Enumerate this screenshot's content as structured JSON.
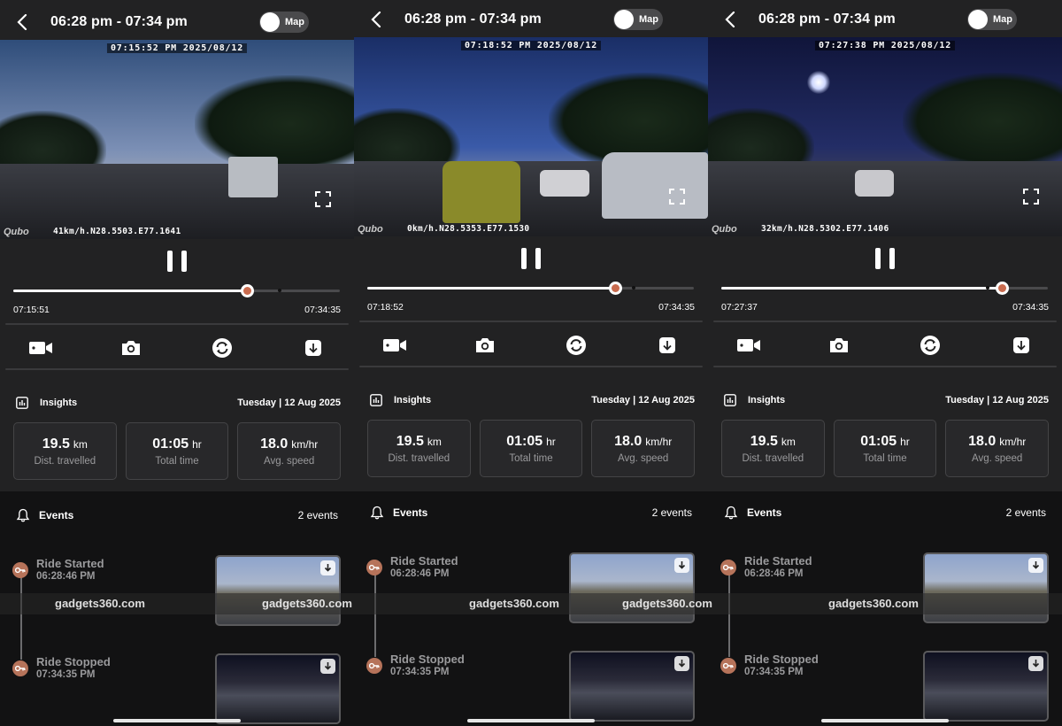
{
  "panels": [
    {
      "header": {
        "title": "06:28 pm - 07:34 pm",
        "map_label": "Map"
      },
      "video": {
        "timestamp": "07:15:52 PM 2025/08/12",
        "gps": "41km/h.N28.5503.E77.1641",
        "logo": "Qubo"
      },
      "playback": {
        "current": "07:15:51",
        "end": "07:34:35",
        "progress": 0.716
      },
      "insights": {
        "title": "Insights",
        "date": "Tuesday | 12 Aug 2025",
        "cards": [
          {
            "value": "19.5",
            "unit": "km",
            "caption": "Dist. travelled"
          },
          {
            "value": "01:05",
            "unit": "hr",
            "caption": "Total time"
          },
          {
            "value": "18.0",
            "unit": "km/hr",
            "caption": "Avg. speed"
          }
        ]
      },
      "events": {
        "title": "Events",
        "count": "2 events",
        "items": [
          {
            "name": "Ride Started",
            "time": "06:28:46 PM"
          },
          {
            "name": "Ride Stopped",
            "time": "07:34:35 PM"
          }
        ]
      }
    },
    {
      "header": {
        "title": "06:28 pm - 07:34 pm",
        "map_label": "Map"
      },
      "video": {
        "timestamp": "07:18:52 PM 2025/08/12",
        "gps": "0km/h.N28.5353.E77.1530",
        "logo": "Qubo"
      },
      "playback": {
        "current": "07:18:52",
        "end": "07:34:35",
        "progress": 0.76
      },
      "insights": {
        "title": "Insights",
        "date": "Tuesday | 12 Aug 2025",
        "cards": [
          {
            "value": "19.5",
            "unit": "km",
            "caption": "Dist. travelled"
          },
          {
            "value": "01:05",
            "unit": "hr",
            "caption": "Total time"
          },
          {
            "value": "18.0",
            "unit": "km/hr",
            "caption": "Avg. speed"
          }
        ]
      },
      "events": {
        "title": "Events",
        "count": "2 events",
        "items": [
          {
            "name": "Ride Started",
            "time": "06:28:46 PM"
          },
          {
            "name": "Ride Stopped",
            "time": "07:34:35 PM"
          }
        ]
      }
    },
    {
      "header": {
        "title": "06:28 pm - 07:34 pm",
        "map_label": "Map"
      },
      "video": {
        "timestamp": "07:27:38 PM 2025/08/12",
        "gps": "32km/h.N28.5302.E77.1406",
        "logo": "Qubo"
      },
      "playback": {
        "current": "07:27:37",
        "end": "07:34:35",
        "progress": 0.86
      },
      "insights": {
        "title": "Insights",
        "date": "Tuesday | 12 Aug 2025",
        "cards": [
          {
            "value": "19.5",
            "unit": "km",
            "caption": "Dist. travelled"
          },
          {
            "value": "01:05",
            "unit": "hr",
            "caption": "Total time"
          },
          {
            "value": "18.0",
            "unit": "km/hr",
            "caption": "Avg. speed"
          }
        ]
      },
      "events": {
        "title": "Events",
        "count": "2 events",
        "items": [
          {
            "name": "Ride Started",
            "time": "06:28:46 PM"
          },
          {
            "name": "Ride Stopped",
            "time": "07:34:35 PM"
          }
        ]
      }
    }
  ],
  "watermark": {
    "text": "gadgets360.com"
  },
  "colors": {
    "accent": "#c96b4e",
    "background": "#121213",
    "surface": "#222223"
  },
  "icons": [
    "back-arrow-icon",
    "pause-icon",
    "fullscreen-icon",
    "video-camera-icon",
    "camera-icon",
    "sync-icon",
    "download-icon",
    "chart-icon",
    "bell-icon",
    "key-icon"
  ]
}
